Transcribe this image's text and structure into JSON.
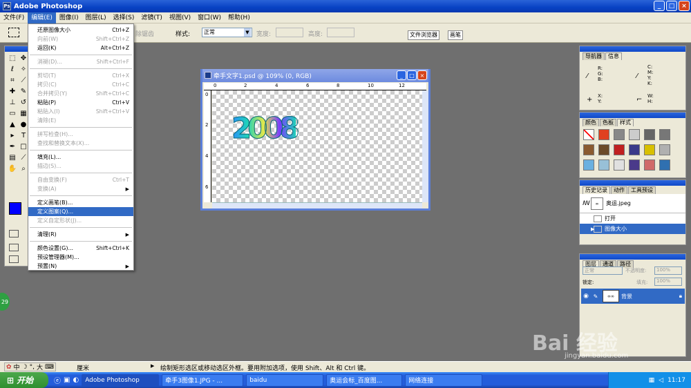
{
  "app": {
    "title": "Adobe Photoshop"
  },
  "menubar": [
    "文件(F)",
    "编辑(E)",
    "图像(I)",
    "图层(L)",
    "选择(S)",
    "滤镜(T)",
    "视图(V)",
    "窗口(W)",
    "帮助(H)"
  ],
  "options": {
    "fade": "除锯齿",
    "style_label": "样式:",
    "style_value": "正常",
    "width_label": "宽度:",
    "height_label": "高度:",
    "tab_browser": "文件浏览器",
    "tab_brush": "画笔"
  },
  "edit_menu": [
    {
      "label": "还原图像大小",
      "shortcut": "Ctrl+Z",
      "disabled": false
    },
    {
      "label": "向前(W)",
      "shortcut": "Shift+Ctrl+Z",
      "disabled": true
    },
    {
      "label": "返回(K)",
      "shortcut": "Alt+Ctrl+Z",
      "disabled": false
    },
    {
      "sep": true
    },
    {
      "label": "消褪(D)...",
      "shortcut": "Shift+Ctrl+F",
      "disabled": true
    },
    {
      "sep": true
    },
    {
      "label": "剪切(T)",
      "shortcut": "Ctrl+X",
      "disabled": true
    },
    {
      "label": "拷贝(C)",
      "shortcut": "Ctrl+C",
      "disabled": true
    },
    {
      "label": "合并拷贝(Y)",
      "shortcut": "Shift+Ctrl+C",
      "disabled": true
    },
    {
      "label": "粘贴(P)",
      "shortcut": "Ctrl+V",
      "disabled": false
    },
    {
      "label": "粘贴入(I)",
      "shortcut": "Shift+Ctrl+V",
      "disabled": true
    },
    {
      "label": "清除(E)",
      "shortcut": "",
      "disabled": true
    },
    {
      "sep": true
    },
    {
      "label": "拼写检查(H)...",
      "shortcut": "",
      "disabled": true
    },
    {
      "label": "查找和替换文本(X)...",
      "shortcut": "",
      "disabled": true
    },
    {
      "sep": true
    },
    {
      "label": "填充(L)...",
      "shortcut": "",
      "disabled": false
    },
    {
      "label": "描边(S)...",
      "shortcut": "",
      "disabled": true
    },
    {
      "sep": true
    },
    {
      "label": "自由变换(F)",
      "shortcut": "Ctrl+T",
      "disabled": true
    },
    {
      "label": "变换(A)",
      "shortcut": "",
      "disabled": true,
      "sub": true
    },
    {
      "sep": true
    },
    {
      "label": "定义画笔(B)...",
      "shortcut": "",
      "disabled": false
    },
    {
      "label": "定义图案(Q)...",
      "shortcut": "",
      "disabled": false,
      "highlight": true
    },
    {
      "label": "定义自定形状(J)...",
      "shortcut": "",
      "disabled": true
    },
    {
      "sep": true
    },
    {
      "label": "清理(R)",
      "shortcut": "",
      "disabled": false,
      "sub": true
    },
    {
      "sep": true
    },
    {
      "label": "颜色设置(G)...",
      "shortcut": "Shift+Ctrl+K",
      "disabled": false
    },
    {
      "label": "预设管理器(M)...",
      "shortcut": "",
      "disabled": false
    },
    {
      "label": "预置(N)",
      "shortcut": "",
      "disabled": false,
      "sub": true
    }
  ],
  "document": {
    "title": "牵手文字1.psd @ 109% (0, RGB)",
    "ruler": [
      "0",
      "2",
      "4",
      "6",
      "8",
      "10",
      "12"
    ],
    "vruler": [
      "0",
      "2",
      "4",
      "6"
    ],
    "art_text": "2008"
  },
  "navigator": {
    "tabs": [
      "导航器",
      "信息"
    ],
    "rgb": "R:\nG:\nB:",
    "cmyk": "C:\nM:\nY:\nK:",
    "xy": "X:\nY:",
    "wh": "W:\nH:"
  },
  "swatches_panel": {
    "tabs": [
      "颜色",
      "色板",
      "样式"
    ]
  },
  "history": {
    "tabs": [
      "历史记录",
      "动作",
      "工具预设"
    ],
    "snapshot": "奥运.jpeg",
    "steps": [
      "打开",
      "图像大小"
    ]
  },
  "layers": {
    "tabs": [
      "图层",
      "通道",
      "路径"
    ],
    "mode": "正常",
    "opacity_label": "不透明度:",
    "opacity": "100%",
    "lock_label": "锁定:",
    "fill_label": "填充:",
    "fill": "100%",
    "layer_name": "背景"
  },
  "status": {
    "unit": "厘米",
    "hint": "绘制矩形选区或移动选区外框。要用附加选项，使用 Shift、Alt 和 Ctrl 键。",
    "ime": "中",
    "zoom_badge": "29"
  },
  "taskbar": {
    "start": "开始",
    "tasks": [
      "Adobe Photoshop",
      "牵手3图像1.JPG - ...",
      "baidu",
      "奥运会标_百度图...",
      "网络连接"
    ],
    "clock": "11:17"
  },
  "watermark": {
    "brand": "Bai 经验",
    "url": "jingyan.baidu.com"
  }
}
